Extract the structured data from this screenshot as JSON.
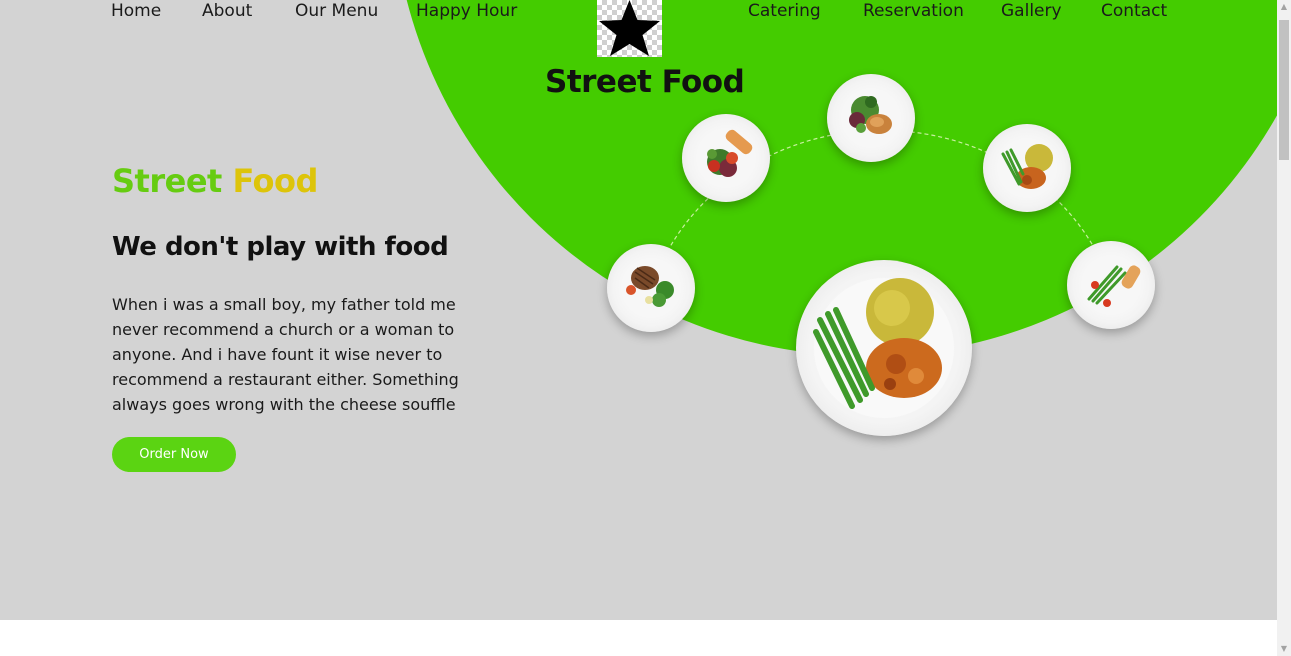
{
  "nav": {
    "left": [
      "Home",
      "About",
      "Our Menu",
      "Happy Hour"
    ],
    "right": [
      "Catering",
      "Reservation",
      "Gallery",
      "Contact"
    ]
  },
  "logo": {
    "icon": "star-icon"
  },
  "brand_heading": "Street Food",
  "hero": {
    "title_word1": "Street",
    "title_word2": "Food",
    "tagline": "We don't play with food",
    "description": "When i was a small boy, my father told me never recommend a church or a woman to anyone. And i have fount it wise never to recommend a restaurant either. Something always goes wrong with the cheese souffle",
    "cta_label": "Order Now"
  },
  "colors": {
    "accent_green": "#44cc00",
    "title_green": "#66cc11",
    "title_yellow": "#ddc40a",
    "button_green": "#5bd412",
    "background": "#d3d3d3"
  },
  "dishes": [
    {
      "name": "salmon-salad-plate"
    },
    {
      "name": "chicken-salad-plate"
    },
    {
      "name": "beans-curry-rice-plate"
    },
    {
      "name": "steak-broccoli-plate"
    },
    {
      "name": "asparagus-fish-plate"
    },
    {
      "name": "featured-curry-plate"
    }
  ]
}
